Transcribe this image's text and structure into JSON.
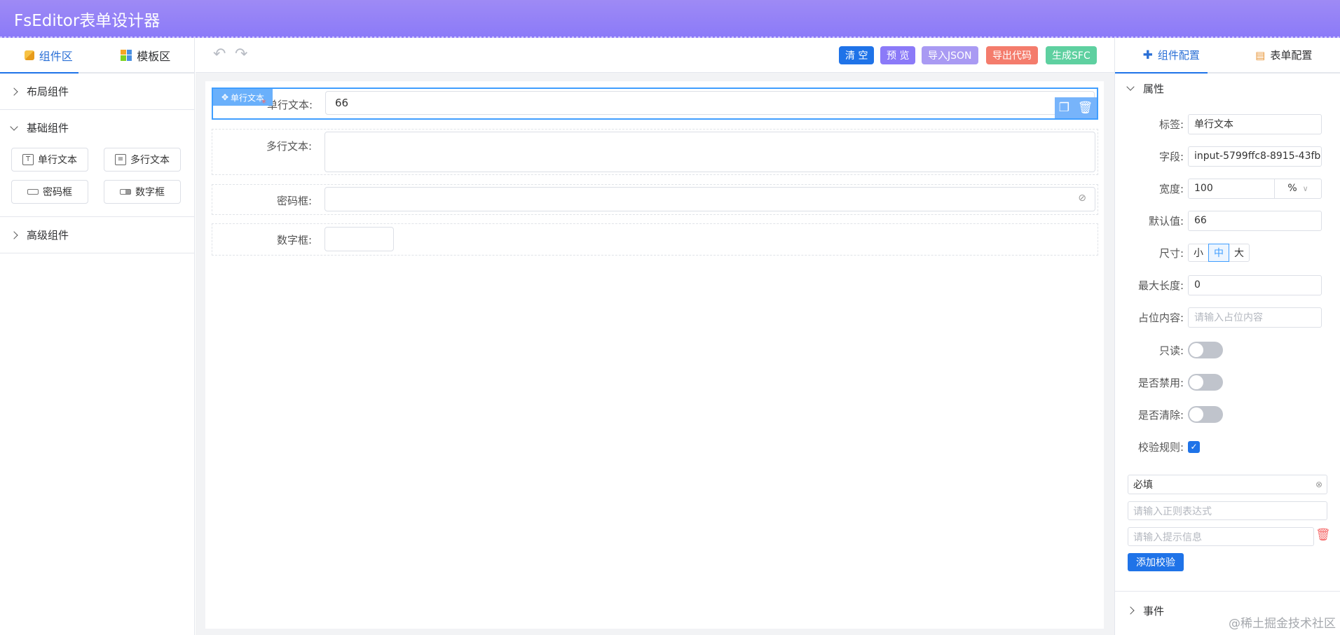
{
  "app": {
    "title": "FsEditor表单设计器"
  },
  "left": {
    "tabs": [
      {
        "label": "组件区",
        "icon": "cube-icon"
      },
      {
        "label": "模板区",
        "icon": "grid-icon"
      }
    ],
    "sections": {
      "layout": {
        "title": "布局组件"
      },
      "basic": {
        "title": "基础组件",
        "items": [
          {
            "label": "单行文本",
            "icon": "text-icon"
          },
          {
            "label": "多行文本",
            "icon": "textarea-icon"
          },
          {
            "label": "密码框",
            "icon": "password-icon"
          },
          {
            "label": "数字框",
            "icon": "number-icon"
          }
        ]
      },
      "advanced": {
        "title": "高级组件"
      }
    }
  },
  "toolbar": {
    "buttons": [
      {
        "label": "清 空",
        "color": "#1f73e8"
      },
      {
        "label": "预 览",
        "color": "#8b7af8"
      },
      {
        "label": "导入JSON",
        "color": "#a99af3"
      },
      {
        "label": "导出代码",
        "color": "#f47c6c"
      },
      {
        "label": "生成SFC",
        "color": "#5ed0a0"
      }
    ]
  },
  "canvas": {
    "drag_tag": "单行文本",
    "fields": [
      {
        "label": "单行文本:",
        "value": "66",
        "required_mark": "*"
      },
      {
        "label": "多行文本:",
        "value": ""
      },
      {
        "label": "密码框:",
        "value": ""
      },
      {
        "label": "数字框:",
        "value": ""
      }
    ]
  },
  "right": {
    "tabs": [
      {
        "label": "组件配置",
        "icon": "puzzle-icon"
      },
      {
        "label": "表单配置",
        "icon": "form-doc-icon"
      }
    ],
    "attributes_title": "属性",
    "props": {
      "label": {
        "label": "标签:",
        "value": "单行文本"
      },
      "field": {
        "label": "字段:",
        "value": "input-5799ffc8-8915-43fb"
      },
      "width": {
        "label": "宽度:",
        "value": "100",
        "unit": "%"
      },
      "default": {
        "label": "默认值:",
        "value": "66"
      },
      "size": {
        "label": "尺寸:",
        "options": [
          "小",
          "中",
          "大"
        ],
        "selected": "中"
      },
      "maxlength": {
        "label": "最大长度:",
        "value": "0"
      },
      "placeholder": {
        "label": "占位内容:",
        "placeholder": "请输入占位内容"
      },
      "readonly": {
        "label": "只读:",
        "on": false
      },
      "disabled": {
        "label": "是否禁用:",
        "on": false
      },
      "clearable": {
        "label": "是否清除:",
        "on": false
      },
      "rules": {
        "label": "校验规则:",
        "checked": true
      }
    },
    "rule": {
      "type_value": "必填",
      "regex_placeholder": "请输入正则表达式",
      "message_placeholder": "请输入提示信息",
      "add_label": "添加校验"
    },
    "events_title": "事件"
  },
  "watermark": "@稀土掘金技术社区"
}
